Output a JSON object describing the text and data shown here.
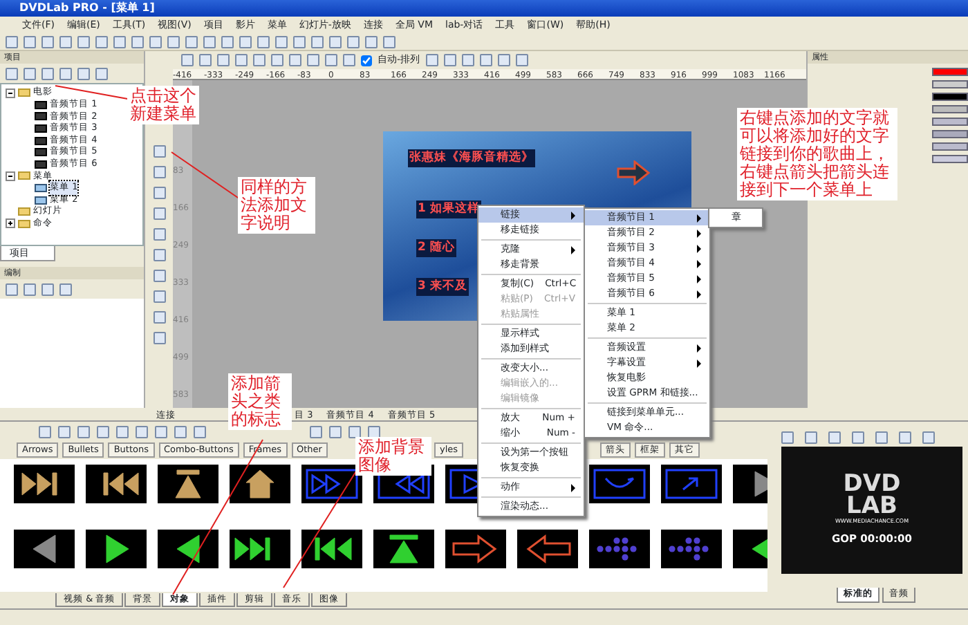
{
  "window": {
    "title": "DVDLab PRO - [菜单 1]"
  },
  "menu_bar": [
    "文件(F)",
    "编辑(E)",
    "工具(T)",
    "视图(V)",
    "项目",
    "影片",
    "菜单",
    "幻灯片-放映",
    "连接",
    "全局 VM",
    "lab-对话",
    "工具",
    "窗口(W)",
    "帮助(H)"
  ],
  "toolbar": {
    "checkbox": {
      "label": "自动-排列",
      "checked": true
    }
  },
  "project_panel": {
    "title": "项目",
    "tab": "项目",
    "tree": [
      {
        "label": "电影",
        "expanded": true,
        "selected": false,
        "children": [
          {
            "label": "音频节目 1",
            "selected": false
          },
          {
            "label": "音频节目 2",
            "selected": false
          },
          {
            "label": "音频节目 3",
            "selected": false
          },
          {
            "label": "音频节目 4",
            "selected": false
          },
          {
            "label": "音频节目 5",
            "selected": false
          },
          {
            "label": "音频节目 6",
            "selected": false
          }
        ]
      },
      {
        "label": "菜单",
        "expanded": true,
        "selected": false,
        "children": [
          {
            "label": "菜单 1",
            "selected": true
          },
          {
            "label": "菜单 2",
            "selected": false
          }
        ]
      },
      {
        "label": "幻灯片",
        "selected": false
      },
      {
        "label": "命令",
        "expanded": false,
        "selected": false
      }
    ]
  },
  "edit_panel": {
    "title": "编制"
  },
  "ruler": {
    "ticks": [
      "-416",
      "-333",
      "-249",
      "-166",
      "-83",
      "0",
      "83",
      "166",
      "249",
      "333",
      "416",
      "499",
      "583",
      "666",
      "749",
      "833",
      "916",
      "999",
      "1083",
      "1166"
    ],
    "vertical_ticks": [
      "83",
      "166",
      "249",
      "333",
      "416",
      "499",
      "583"
    ]
  },
  "canvas": {
    "menu_title": "张惠妹《海豚音精选》",
    "items": [
      "1 如果这样",
      "2 随心",
      "3 来不及"
    ]
  },
  "context_menu": {
    "items": [
      {
        "kind": "item",
        "label": "链接",
        "submenu": true,
        "selected": true,
        "disabled": false
      },
      {
        "kind": "item",
        "label": "移走链接",
        "submenu": false,
        "selected": false,
        "disabled": false
      },
      {
        "kind": "separator"
      },
      {
        "kind": "item",
        "label": "克隆",
        "submenu": true,
        "selected": false,
        "disabled": false
      },
      {
        "kind": "item",
        "label": "移走背景",
        "submenu": false,
        "selected": false,
        "disabled": false
      },
      {
        "kind": "separator"
      },
      {
        "kind": "item",
        "label": "复制(C)",
        "shortcut": "Ctrl+C",
        "submenu": false,
        "selected": false,
        "disabled": false
      },
      {
        "kind": "item",
        "label": "粘贴(P)",
        "shortcut": "Ctrl+V",
        "submenu": false,
        "selected": false,
        "disabled": true
      },
      {
        "kind": "item",
        "label": "粘贴属性",
        "submenu": false,
        "selected": false,
        "disabled": true
      },
      {
        "kind": "separator"
      },
      {
        "kind": "item",
        "label": "显示样式",
        "submenu": false,
        "selected": false,
        "disabled": false
      },
      {
        "kind": "item",
        "label": "添加到样式",
        "submenu": false,
        "selected": false,
        "disabled": false
      },
      {
        "kind": "separator"
      },
      {
        "kind": "item",
        "label": "改变大小...",
        "submenu": false,
        "selected": false,
        "disabled": false
      },
      {
        "kind": "item",
        "label": "编辑嵌入的...",
        "submenu": false,
        "selected": false,
        "disabled": true
      },
      {
        "kind": "item",
        "label": "编辑镜像",
        "submenu": false,
        "selected": false,
        "disabled": true
      },
      {
        "kind": "separator"
      },
      {
        "kind": "item",
        "label": "放大",
        "shortcut": "Num +",
        "submenu": false,
        "selected": false,
        "disabled": false
      },
      {
        "kind": "item",
        "label": "缩小",
        "shortcut": "Num -",
        "submenu": false,
        "selected": false,
        "disabled": false
      },
      {
        "kind": "separator"
      },
      {
        "kind": "item",
        "label": "设为第一个按钮",
        "submenu": false,
        "selected": false,
        "disabled": false
      },
      {
        "kind": "item",
        "label": "恢复变换",
        "submenu": false,
        "selected": false,
        "disabled": false
      },
      {
        "kind": "separator"
      },
      {
        "kind": "item",
        "label": "动作",
        "submenu": true,
        "selected": false,
        "disabled": false
      },
      {
        "kind": "separator"
      },
      {
        "kind": "item",
        "label": "渲染动态...",
        "submenu": false,
        "selected": false,
        "disabled": false
      }
    ]
  },
  "submenu": {
    "items": [
      {
        "kind": "item",
        "label": "音频节目 1",
        "submenu": true,
        "selected": true
      },
      {
        "kind": "item",
        "label": "音频节目 2",
        "submenu": true,
        "selected": false
      },
      {
        "kind": "item",
        "label": "音频节目 3",
        "submenu": true,
        "selected": false
      },
      {
        "kind": "item",
        "label": "音频节目 4",
        "submenu": true,
        "selected": false
      },
      {
        "kind": "item",
        "label": "音频节目 5",
        "submenu": true,
        "selected": false
      },
      {
        "kind": "item",
        "label": "音频节目 6",
        "submenu": true,
        "selected": false
      },
      {
        "kind": "separator"
      },
      {
        "kind": "item",
        "label": "菜单 1",
        "submenu": false,
        "selected": false
      },
      {
        "kind": "item",
        "label": "菜单 2",
        "submenu": false,
        "selected": false
      },
      {
        "kind": "separator"
      },
      {
        "kind": "item",
        "label": "音频设置",
        "submenu": true,
        "selected": false
      },
      {
        "kind": "item",
        "label": "字幕设置",
        "submenu": true,
        "selected": false
      },
      {
        "kind": "item",
        "label": "恢复电影",
        "submenu": false,
        "selected": false
      },
      {
        "kind": "item",
        "label": "设置 GPRM 和链接...",
        "submenu": false,
        "selected": false
      },
      {
        "kind": "separator"
      },
      {
        "kind": "item",
        "label": "链接到菜单单元...",
        "submenu": false,
        "selected": false
      },
      {
        "kind": "item",
        "label": "VM 命令...",
        "submenu": false,
        "selected": false
      }
    ]
  },
  "third_menu": {
    "items": [
      "章"
    ]
  },
  "annotations": [
    "点击这个新建菜单",
    "同样的方法添加文字说明",
    "右键点添加的文字就可以将添加好的文字链接到你的歌曲上，右键点箭头把箭头连接到下一个菜单上",
    "添加箭头之类的标志",
    "添加背景图像"
  ],
  "property_panel": {
    "title": "属性"
  },
  "document_tabs": [
    "连接",
    "目 3",
    "音频节目 4",
    "音频节目 5"
  ],
  "library": {
    "folder_tabs": [
      "Arrows",
      "Bullets",
      "Buttons",
      "Combo-Buttons",
      "Frames",
      "Other",
      "yles",
      "箭头",
      "框架",
      "其它"
    ],
    "bottom_tabs": [
      {
        "label": "视频 & 音频",
        "selected": false
      },
      {
        "label": "背景",
        "selected": false
      },
      {
        "label": "对象",
        "selected": true
      },
      {
        "label": "插件",
        "selected": false
      },
      {
        "label": "剪辑",
        "selected": false
      },
      {
        "label": "音乐",
        "selected": false
      },
      {
        "label": "图像",
        "selected": false
      }
    ]
  },
  "preview": {
    "logo": [
      "DVD",
      "LAB"
    ],
    "url": "WWW.MEDIACHANCE.COM",
    "timecode": "GOP 00:00:00",
    "tabs": [
      {
        "label": "标准的",
        "selected": true
      },
      {
        "label": "音频",
        "selected": false
      }
    ]
  }
}
